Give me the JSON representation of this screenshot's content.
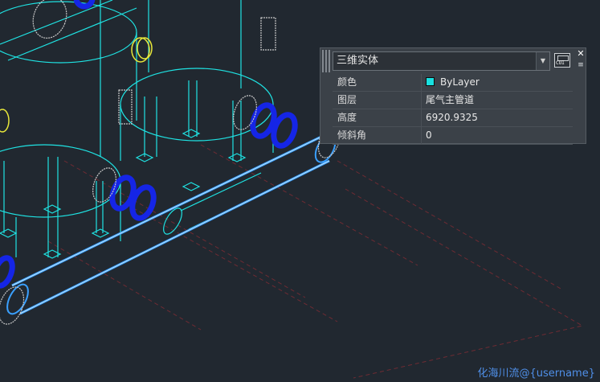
{
  "quick_properties": {
    "object_type": "三维实体",
    "rows": [
      {
        "label": "颜色",
        "value": "ByLayer",
        "swatch_color": "#19e0e0"
      },
      {
        "label": "图层",
        "value": "尾气主管道"
      },
      {
        "label": "高度",
        "value": "6920.9325"
      },
      {
        "label": "倾斜角",
        "value": "0"
      }
    ],
    "cui_label": "CUI"
  },
  "watermark": "化海川流@{username}",
  "colors": {
    "background": "#212830",
    "wireframe_cyan": "#1fe3e3",
    "selected_blue": "#3aa0ff",
    "flange_blue": "#1525e6",
    "flange_yellow": "#e8e83a",
    "grid_red": "#6e2b33",
    "bolt_gray": "#c8c8c8"
  }
}
